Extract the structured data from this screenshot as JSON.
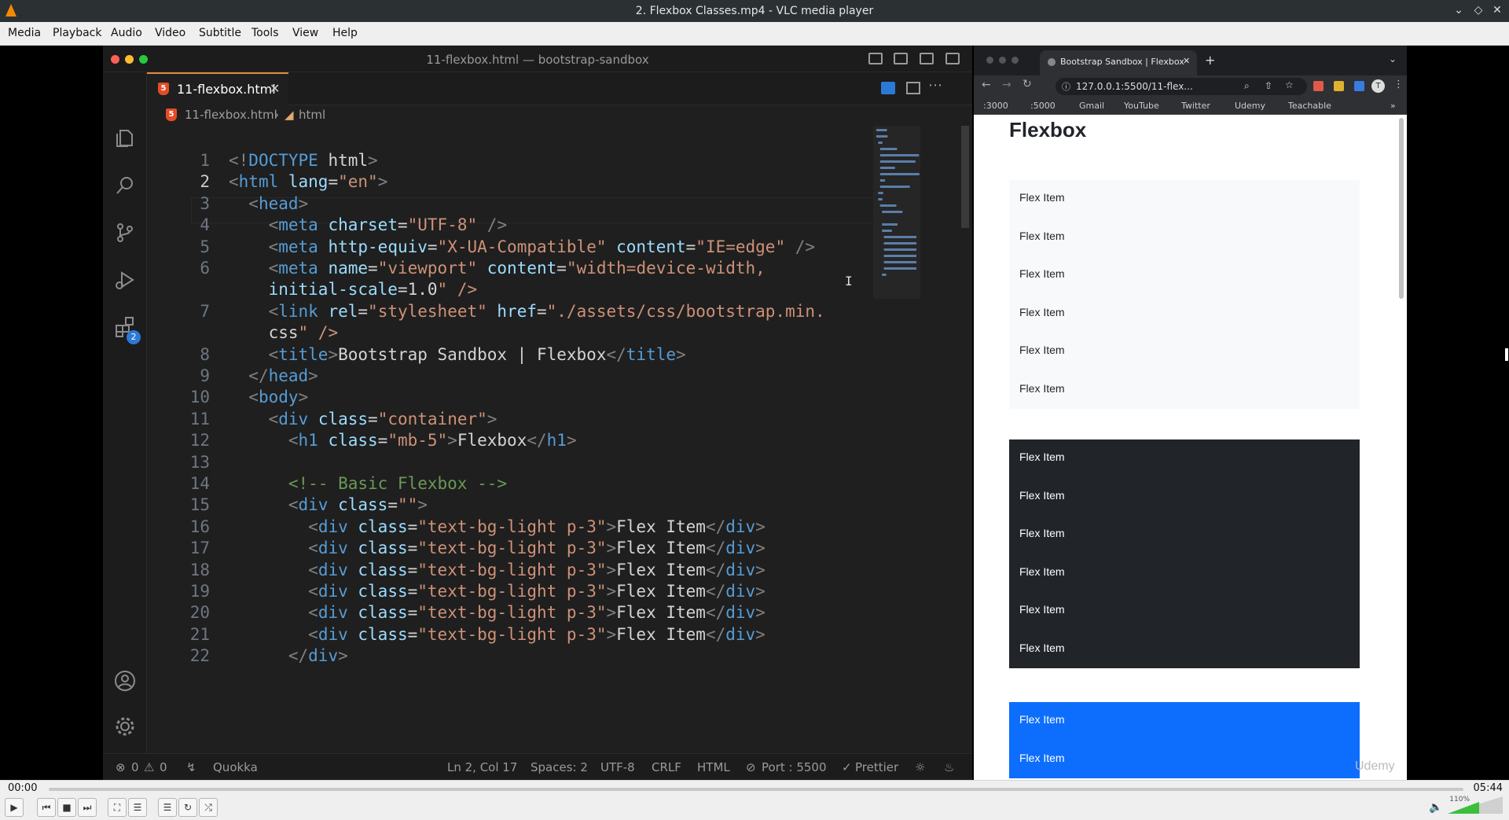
{
  "window": {
    "title": "2. Flexbox Classes.mp4 - VLC media player"
  },
  "menu": {
    "items": [
      "Media",
      "Playback",
      "Audio",
      "Video",
      "Subtitle",
      "Tools",
      "View",
      "Help"
    ]
  },
  "vscode": {
    "window_title": "11-flexbox.html — bootstrap-sandbox",
    "tab_label": "11-flexbox.html",
    "breadcrumb": {
      "file": "11-flexbox.html",
      "element": "html"
    },
    "extensions_badge": "2",
    "line_numbers": [
      "1",
      "2",
      "3",
      "4",
      "5",
      "6",
      "",
      "7",
      "",
      "8",
      "9",
      "10",
      "11",
      "12",
      "13",
      "14",
      "15",
      "16",
      "17",
      "18",
      "19",
      "20",
      "21",
      "22"
    ],
    "status": {
      "errors": "0",
      "warnings": "0",
      "quokka": "Quokka",
      "position": "Ln 2, Col 17",
      "spaces": "Spaces: 2",
      "encoding": "UTF-8",
      "eol": "CRLF",
      "language": "HTML",
      "port": "Port : 5500",
      "prettier": "Prettier"
    }
  },
  "code_lines": [
    "<!DOCTYPE html>",
    "<html lang=\"en\">",
    "  <head>",
    "    <meta charset=\"UTF-8\" />",
    "    <meta http-equiv=\"X-UA-Compatible\" content=\"IE=edge\" />",
    "    <meta name=\"viewport\" content=\"width=device-width,",
    "    initial-scale=1.0\" />",
    "    <link rel=\"stylesheet\" href=\"./assets/css/bootstrap.min.",
    "    css\" />",
    "    <title>Bootstrap Sandbox | Flexbox</title>",
    "  </head>",
    "  <body>",
    "    <div class=\"container\">",
    "      <h1 class=\"mb-5\">Flexbox</h1>",
    "",
    "      <!-- Basic Flexbox -->",
    "      <div class=\"\">",
    "        <div class=\"text-bg-light p-3\">Flex Item</div>",
    "        <div class=\"text-bg-light p-3\">Flex Item</div>",
    "        <div class=\"text-bg-light p-3\">Flex Item</div>",
    "        <div class=\"text-bg-light p-3\">Flex Item</div>",
    "        <div class=\"text-bg-light p-3\">Flex Item</div>",
    "        <div class=\"text-bg-light p-3\">Flex Item</div>",
    "      </div>"
  ],
  "browser": {
    "tab_title": "Bootstrap Sandbox | Flexbox",
    "url": "127.0.0.1:5500/11-flex...",
    "bookmarks": [
      ":3000",
      ":5000",
      "Gmail",
      "YouTube",
      "Twitter",
      "Udemy",
      "Teachable"
    ],
    "page_heading": "Flexbox",
    "flex_item_label": "Flex Item",
    "light_box_items": [
      "Flex Item",
      "Flex Item",
      "Flex Item",
      "Flex Item",
      "Flex Item",
      "Flex Item"
    ],
    "dark_box_items": [
      "Flex Item",
      "Flex Item",
      "Flex Item",
      "Flex Item",
      "Flex Item",
      "Flex Item"
    ],
    "blue_box_items": [
      "Flex Item",
      "Flex Item"
    ],
    "watermark": "Udemy"
  },
  "player": {
    "time_current": "00:00",
    "time_total": "05:44",
    "volume": "110%",
    "volume_level": 1.1
  },
  "colors": {
    "vlc_accent": "#f28a00",
    "tab_accent": "#e38b3c",
    "dark_box": "#212529",
    "blue_box": "#0d6efd",
    "light_box": "#f8f9fa"
  }
}
